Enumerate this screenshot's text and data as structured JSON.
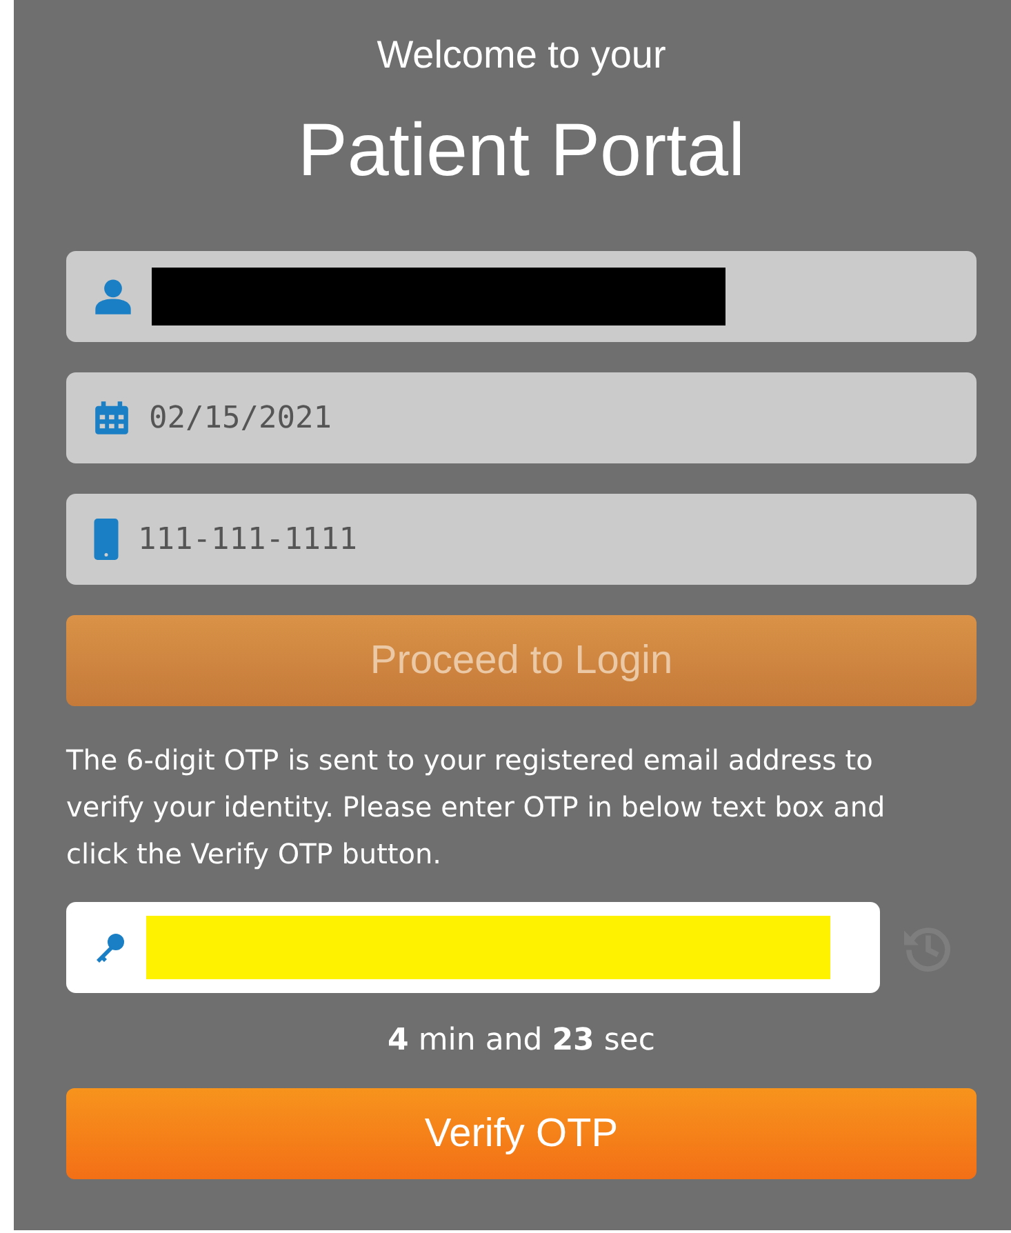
{
  "header": {
    "greeting": "Welcome to your",
    "title": "Patient Portal"
  },
  "fields": [
    {
      "kind": "user",
      "redacted": true,
      "disabled": true
    },
    {
      "kind": "date",
      "value": "02/15/2021",
      "redacted": false,
      "disabled": true
    },
    {
      "kind": "phone",
      "value": "111-111-1111",
      "redacted": false,
      "disabled": true
    }
  ],
  "proceed_button": {
    "label": "Proceed to Login",
    "disabled": true
  },
  "instructions": "The 6-digit OTP is sent to your registered email address to verify your identity. Please enter OTP in below text box and click the Verify OTP button.",
  "otp_field": {
    "kind": "key",
    "highlighted": true,
    "disabled": false
  },
  "resend": {
    "disabled": true
  },
  "timer": "**4** min and **23** sec",
  "verify_button": {
    "label": "Verify OTP",
    "disabled": false
  }
}
